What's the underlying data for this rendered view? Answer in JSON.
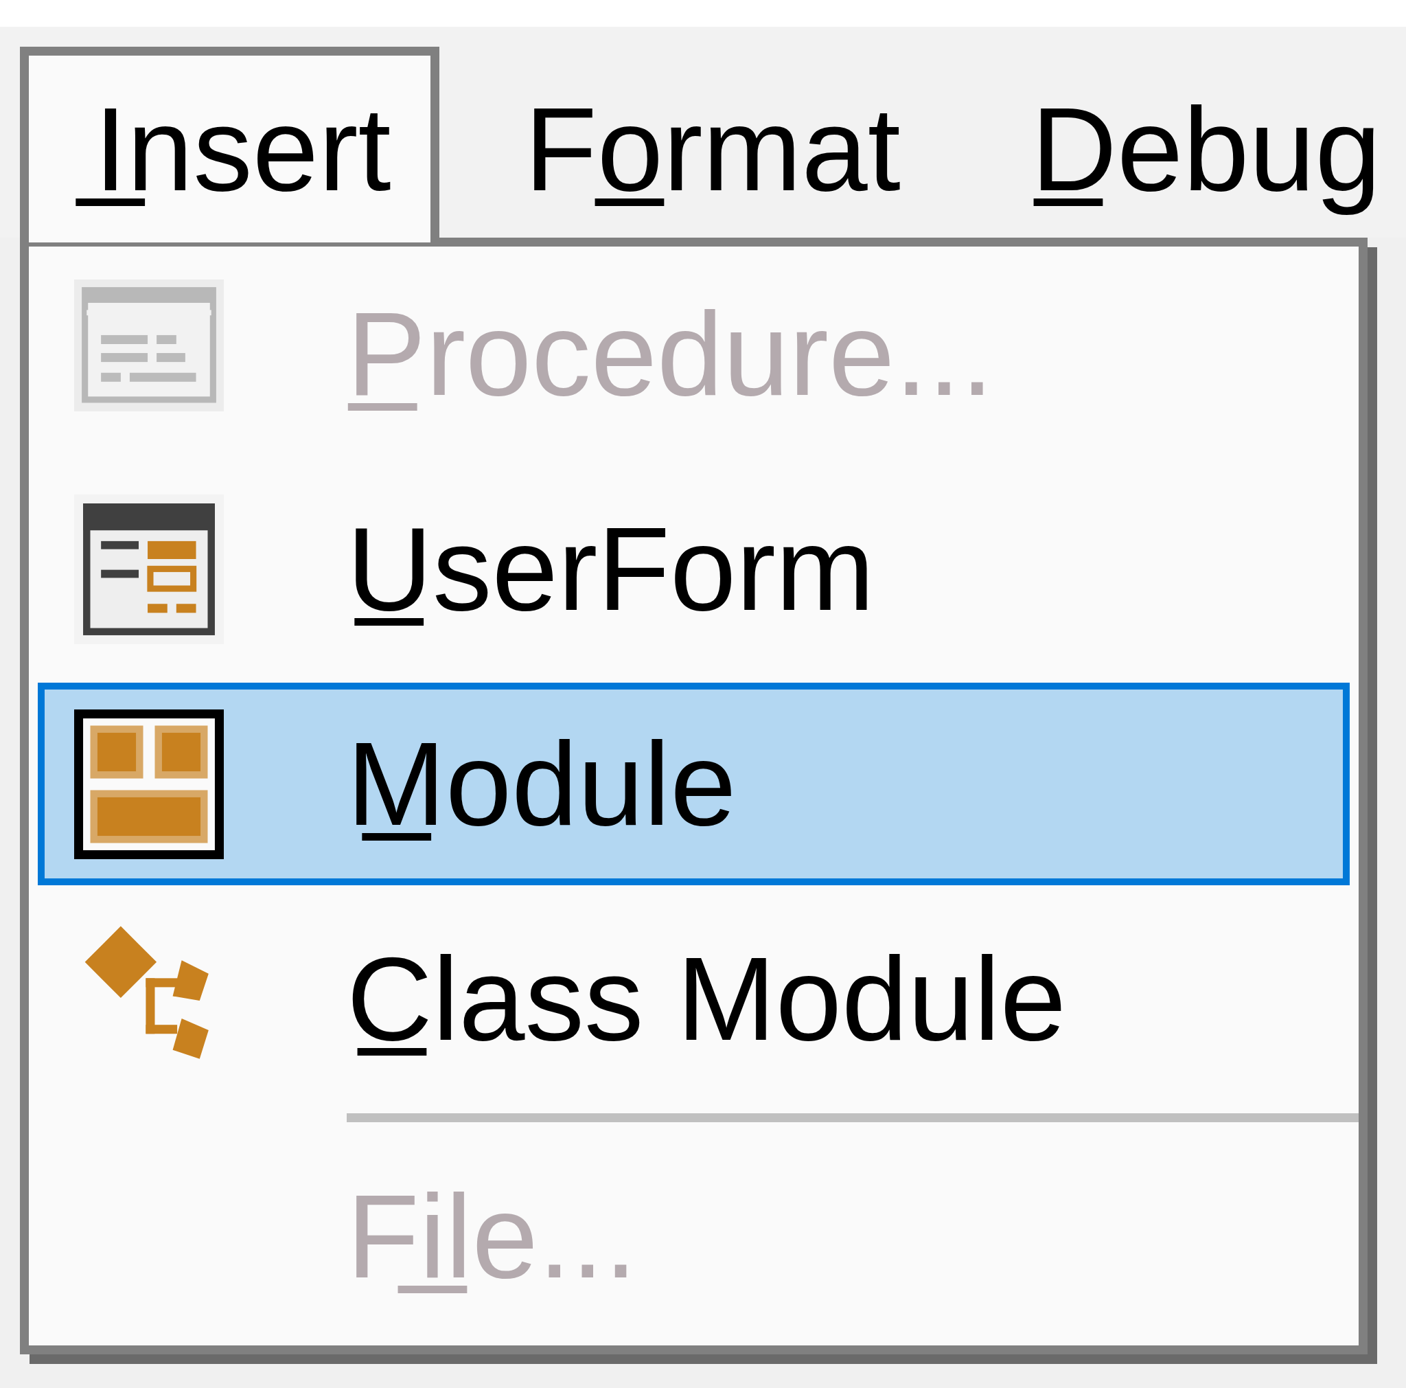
{
  "menubar": [
    {
      "label": "I̲nsert",
      "open": true
    },
    {
      "label": "Fo̲rmat",
      "open": false
    },
    {
      "label": "D̲ebug",
      "open": false
    }
  ],
  "menu": {
    "items": [
      {
        "kind": "command",
        "label": "P̲rocedure...",
        "disabled": true,
        "selected": false
      },
      {
        "kind": "command",
        "label": "U̲serForm",
        "disabled": false,
        "selected": false
      },
      {
        "kind": "command",
        "label": "M̲odule",
        "disabled": false,
        "selected": true
      },
      {
        "kind": "command",
        "label": "C̲lass Module",
        "disabled": false,
        "selected": false
      },
      {
        "kind": "separator"
      },
      {
        "kind": "command",
        "label": "Fi̲le...",
        "disabled": true,
        "selected": false
      }
    ]
  }
}
